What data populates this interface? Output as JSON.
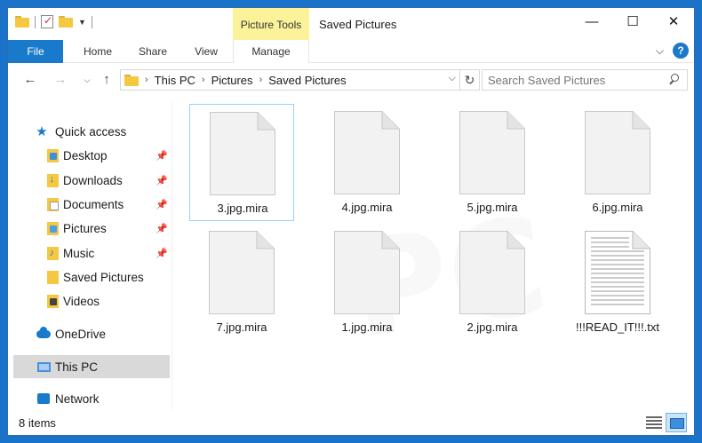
{
  "window": {
    "title": "Saved Pictures",
    "picture_tools": "Picture Tools",
    "minimize": "—",
    "maximize": "☐",
    "close": "✕"
  },
  "ribbon": {
    "tabs": [
      "File",
      "Home",
      "Share",
      "View",
      "Manage"
    ],
    "help": "?",
    "collapse": "⌵"
  },
  "address": {
    "back": "←",
    "forward": "→",
    "recent": "⌵",
    "up": "↑",
    "crumbs": [
      "This PC",
      "Pictures",
      "Saved Pictures"
    ],
    "dropdown": "⌵",
    "refresh": "↻"
  },
  "search": {
    "placeholder": "Search Saved Pictures"
  },
  "sidebar": {
    "quick_access": "Quick access",
    "items": [
      {
        "label": "Desktop",
        "pinned": true
      },
      {
        "label": "Downloads",
        "pinned": true
      },
      {
        "label": "Documents",
        "pinned": true
      },
      {
        "label": "Pictures",
        "pinned": true
      },
      {
        "label": "Music",
        "pinned": true
      },
      {
        "label": "Saved Pictures",
        "pinned": false
      },
      {
        "label": "Videos",
        "pinned": false
      }
    ],
    "onedrive": "OneDrive",
    "this_pc": "This PC",
    "network": "Network"
  },
  "files": [
    {
      "name": "3.jpg.mira",
      "type": "blank",
      "selected": true
    },
    {
      "name": "4.jpg.mira",
      "type": "blank",
      "selected": false
    },
    {
      "name": "5.jpg.mira",
      "type": "blank",
      "selected": false
    },
    {
      "name": "6.jpg.mira",
      "type": "blank",
      "selected": false
    },
    {
      "name": "7.jpg.mira",
      "type": "blank",
      "selected": false
    },
    {
      "name": "1.jpg.mira",
      "type": "blank",
      "selected": false
    },
    {
      "name": "2.jpg.mira",
      "type": "blank",
      "selected": false
    },
    {
      "name": "!!!READ_IT!!!.txt",
      "type": "text",
      "selected": false
    }
  ],
  "status": {
    "item_count": "8 items"
  }
}
